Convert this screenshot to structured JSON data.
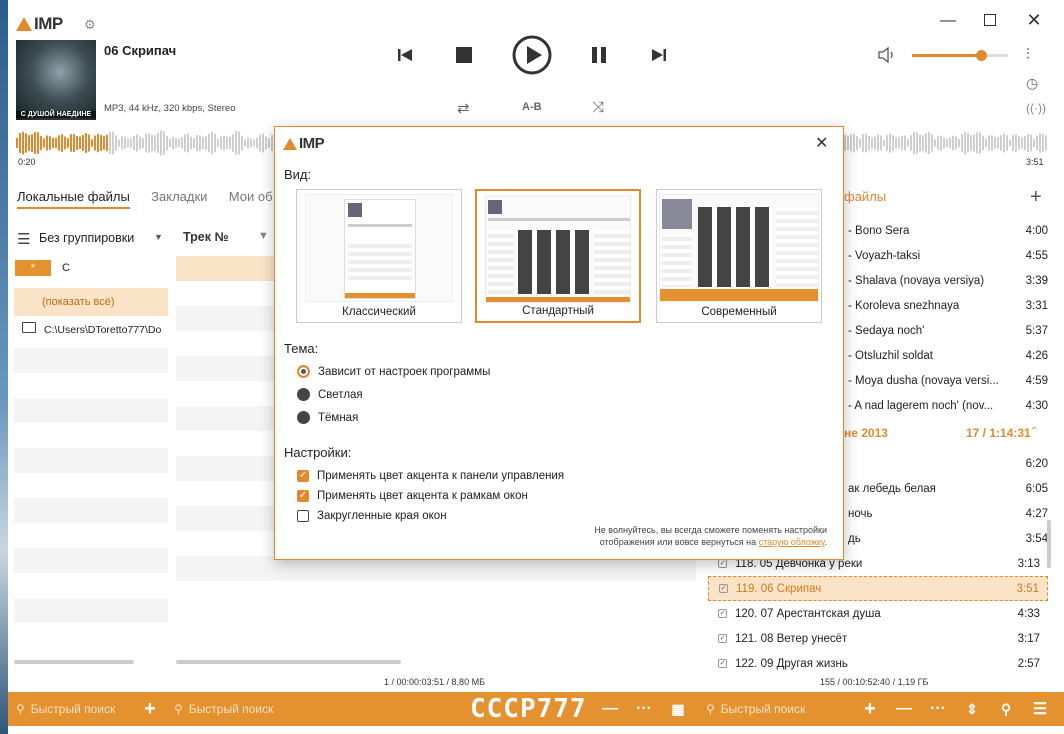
{
  "app": {
    "name": "IMP"
  },
  "colors": {
    "accent": "#e08a2e",
    "bottom_bar": "#e4922f"
  },
  "now_playing": {
    "title": "06 Скрипач",
    "info": "MP3, 44 kHz, 320 kbps, Stereo",
    "cover_caption": "С ДУШОЙ НАЕДИНЕ",
    "time_elapsed": "0:20",
    "time_total": "3:51",
    "ab_label": "A-B",
    "volume_level": 0.72,
    "progress_fraction": 0.09
  },
  "tabs": {
    "local": "Локальные файлы",
    "bookmarks": "Закладки",
    "my": "Мои об",
    "right": "файлы"
  },
  "left_panel": {
    "grouping": "Без группировки",
    "column_track": "Трек №",
    "letter_star": "*",
    "letter_c": "С",
    "show_all": "(показать всё)",
    "path": "C:\\Users\\DToretto777\\Do",
    "status": "1 / 00:00:03:51 / 8,80 МБ"
  },
  "playlist": {
    "top_items": [
      {
        "title": "- Bono Sera",
        "duration": "4:00"
      },
      {
        "title": "- Voyazh-taksi",
        "duration": "4:55"
      },
      {
        "title": "- Shalava (novaya versiya)",
        "duration": "3:39"
      },
      {
        "title": "- Koroleva snezhnaya",
        "duration": "3:31"
      },
      {
        "title": "- Sedaya noch'",
        "duration": "5:37"
      },
      {
        "title": "- Otsluzhil soldat",
        "duration": "4:26"
      },
      {
        "title": "- Moya dusha (novaya versi...",
        "duration": "4:59"
      },
      {
        "title": "- A nad lagerem noch' (nov...",
        "duration": "4:30"
      }
    ],
    "group_title": "не 2013",
    "group_info": "17 / 1:14:31",
    "group_items": [
      {
        "title": "",
        "duration": "6:20"
      },
      {
        "title": "ак лебедь белая",
        "duration": "6:05"
      },
      {
        "title": "ночь",
        "duration": "4:27"
      },
      {
        "title": "дь",
        "duration": "3:54"
      },
      {
        "title": "118. 05 Девчонка у реки",
        "duration": "3:13"
      },
      {
        "title": "119. 06 Скрипач",
        "duration": "3:51"
      },
      {
        "title": "120. 07 Арестантская душа",
        "duration": "4:33"
      },
      {
        "title": "121. 08 Ветер унесёт",
        "duration": "3:17"
      },
      {
        "title": "122. 09 Другая жизнь",
        "duration": "2:57"
      }
    ],
    "status": "155 / 00:10:52:40 / 1,19 ГБ"
  },
  "bottom": {
    "search_placeholder": "Быстрый поиск",
    "watermark": "СССР777"
  },
  "dialog": {
    "section_view": "Вид:",
    "layouts": [
      "Классический",
      "Стандартный",
      "Современный"
    ],
    "selected_layout": "Стандартный",
    "section_theme": "Тема:",
    "themes": [
      "Зависит от настроек программы",
      "Светлая",
      "Тёмная"
    ],
    "selected_theme": "Зависит от настроек программы",
    "section_settings": "Настройки:",
    "settings": [
      {
        "label": "Применять цвет акцента к панели управления",
        "checked": true
      },
      {
        "label": "Применять цвет акцента к рамкам окон",
        "checked": true
      },
      {
        "label": "Закругленные края окон",
        "checked": false
      }
    ],
    "note_line1": "Не волнуйтесь, вы всегда сможете поменять настройки",
    "note_line2": "отображения или вовсе вернуться на ",
    "note_link": "старую обложку",
    "note_end": "."
  }
}
